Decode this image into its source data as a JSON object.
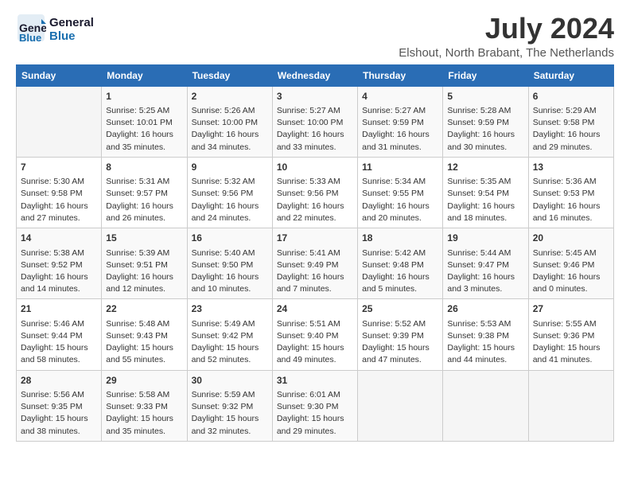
{
  "header": {
    "logo_line1": "General",
    "logo_line2": "Blue",
    "month": "July 2024",
    "location": "Elshout, North Brabant, The Netherlands"
  },
  "days_of_week": [
    "Sunday",
    "Monday",
    "Tuesday",
    "Wednesday",
    "Thursday",
    "Friday",
    "Saturday"
  ],
  "weeks": [
    [
      {
        "day": "",
        "info": ""
      },
      {
        "day": "1",
        "info": "Sunrise: 5:25 AM\nSunset: 10:01 PM\nDaylight: 16 hours\nand 35 minutes."
      },
      {
        "day": "2",
        "info": "Sunrise: 5:26 AM\nSunset: 10:00 PM\nDaylight: 16 hours\nand 34 minutes."
      },
      {
        "day": "3",
        "info": "Sunrise: 5:27 AM\nSunset: 10:00 PM\nDaylight: 16 hours\nand 33 minutes."
      },
      {
        "day": "4",
        "info": "Sunrise: 5:27 AM\nSunset: 9:59 PM\nDaylight: 16 hours\nand 31 minutes."
      },
      {
        "day": "5",
        "info": "Sunrise: 5:28 AM\nSunset: 9:59 PM\nDaylight: 16 hours\nand 30 minutes."
      },
      {
        "day": "6",
        "info": "Sunrise: 5:29 AM\nSunset: 9:58 PM\nDaylight: 16 hours\nand 29 minutes."
      }
    ],
    [
      {
        "day": "7",
        "info": "Sunrise: 5:30 AM\nSunset: 9:58 PM\nDaylight: 16 hours\nand 27 minutes."
      },
      {
        "day": "8",
        "info": "Sunrise: 5:31 AM\nSunset: 9:57 PM\nDaylight: 16 hours\nand 26 minutes."
      },
      {
        "day": "9",
        "info": "Sunrise: 5:32 AM\nSunset: 9:56 PM\nDaylight: 16 hours\nand 24 minutes."
      },
      {
        "day": "10",
        "info": "Sunrise: 5:33 AM\nSunset: 9:56 PM\nDaylight: 16 hours\nand 22 minutes."
      },
      {
        "day": "11",
        "info": "Sunrise: 5:34 AM\nSunset: 9:55 PM\nDaylight: 16 hours\nand 20 minutes."
      },
      {
        "day": "12",
        "info": "Sunrise: 5:35 AM\nSunset: 9:54 PM\nDaylight: 16 hours\nand 18 minutes."
      },
      {
        "day": "13",
        "info": "Sunrise: 5:36 AM\nSunset: 9:53 PM\nDaylight: 16 hours\nand 16 minutes."
      }
    ],
    [
      {
        "day": "14",
        "info": "Sunrise: 5:38 AM\nSunset: 9:52 PM\nDaylight: 16 hours\nand 14 minutes."
      },
      {
        "day": "15",
        "info": "Sunrise: 5:39 AM\nSunset: 9:51 PM\nDaylight: 16 hours\nand 12 minutes."
      },
      {
        "day": "16",
        "info": "Sunrise: 5:40 AM\nSunset: 9:50 PM\nDaylight: 16 hours\nand 10 minutes."
      },
      {
        "day": "17",
        "info": "Sunrise: 5:41 AM\nSunset: 9:49 PM\nDaylight: 16 hours\nand 7 minutes."
      },
      {
        "day": "18",
        "info": "Sunrise: 5:42 AM\nSunset: 9:48 PM\nDaylight: 16 hours\nand 5 minutes."
      },
      {
        "day": "19",
        "info": "Sunrise: 5:44 AM\nSunset: 9:47 PM\nDaylight: 16 hours\nand 3 minutes."
      },
      {
        "day": "20",
        "info": "Sunrise: 5:45 AM\nSunset: 9:46 PM\nDaylight: 16 hours\nand 0 minutes."
      }
    ],
    [
      {
        "day": "21",
        "info": "Sunrise: 5:46 AM\nSunset: 9:44 PM\nDaylight: 15 hours\nand 58 minutes."
      },
      {
        "day": "22",
        "info": "Sunrise: 5:48 AM\nSunset: 9:43 PM\nDaylight: 15 hours\nand 55 minutes."
      },
      {
        "day": "23",
        "info": "Sunrise: 5:49 AM\nSunset: 9:42 PM\nDaylight: 15 hours\nand 52 minutes."
      },
      {
        "day": "24",
        "info": "Sunrise: 5:51 AM\nSunset: 9:40 PM\nDaylight: 15 hours\nand 49 minutes."
      },
      {
        "day": "25",
        "info": "Sunrise: 5:52 AM\nSunset: 9:39 PM\nDaylight: 15 hours\nand 47 minutes."
      },
      {
        "day": "26",
        "info": "Sunrise: 5:53 AM\nSunset: 9:38 PM\nDaylight: 15 hours\nand 44 minutes."
      },
      {
        "day": "27",
        "info": "Sunrise: 5:55 AM\nSunset: 9:36 PM\nDaylight: 15 hours\nand 41 minutes."
      }
    ],
    [
      {
        "day": "28",
        "info": "Sunrise: 5:56 AM\nSunset: 9:35 PM\nDaylight: 15 hours\nand 38 minutes."
      },
      {
        "day": "29",
        "info": "Sunrise: 5:58 AM\nSunset: 9:33 PM\nDaylight: 15 hours\nand 35 minutes."
      },
      {
        "day": "30",
        "info": "Sunrise: 5:59 AM\nSunset: 9:32 PM\nDaylight: 15 hours\nand 32 minutes."
      },
      {
        "day": "31",
        "info": "Sunrise: 6:01 AM\nSunset: 9:30 PM\nDaylight: 15 hours\nand 29 minutes."
      },
      {
        "day": "",
        "info": ""
      },
      {
        "day": "",
        "info": ""
      },
      {
        "day": "",
        "info": ""
      }
    ]
  ]
}
